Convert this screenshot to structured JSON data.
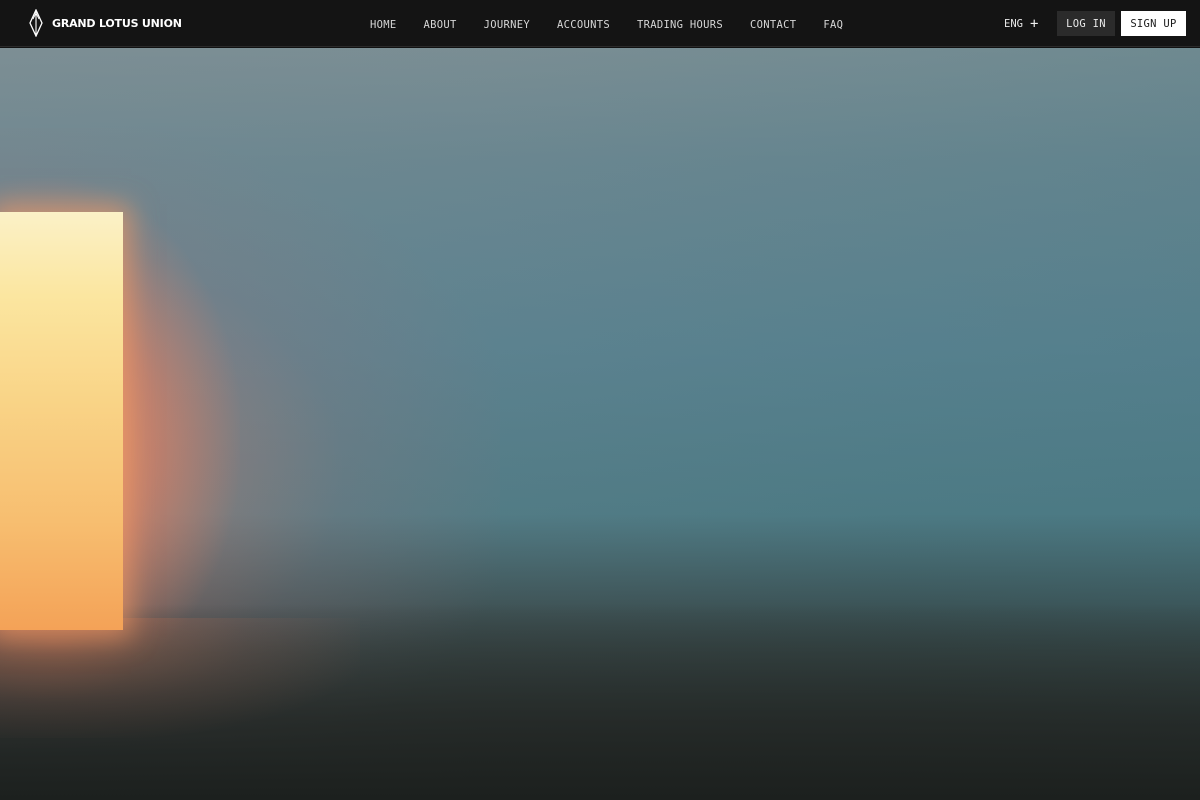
{
  "brand": {
    "name": "GRAND LOTUS UNION",
    "logo_icon": "diamond-logo-icon"
  },
  "nav": {
    "links": [
      {
        "label": "HOME"
      },
      {
        "label": "ABOUT"
      },
      {
        "label": "JOURNEY"
      },
      {
        "label": "ACCOUNTS"
      },
      {
        "label": "TRADING HOURS"
      },
      {
        "label": "CONTACT"
      },
      {
        "label": "FAQ"
      }
    ]
  },
  "language": {
    "label": "ENG",
    "icon": "plus-icon"
  },
  "auth": {
    "login_label": "LOG IN",
    "signup_label": "SIGN UP"
  },
  "colors": {
    "navbar_bg": "#141414",
    "login_bg": "#2b2b2b",
    "signup_bg": "#ffffff",
    "doorway_glow": "#f7bd6f",
    "fog": "#5a8290"
  }
}
